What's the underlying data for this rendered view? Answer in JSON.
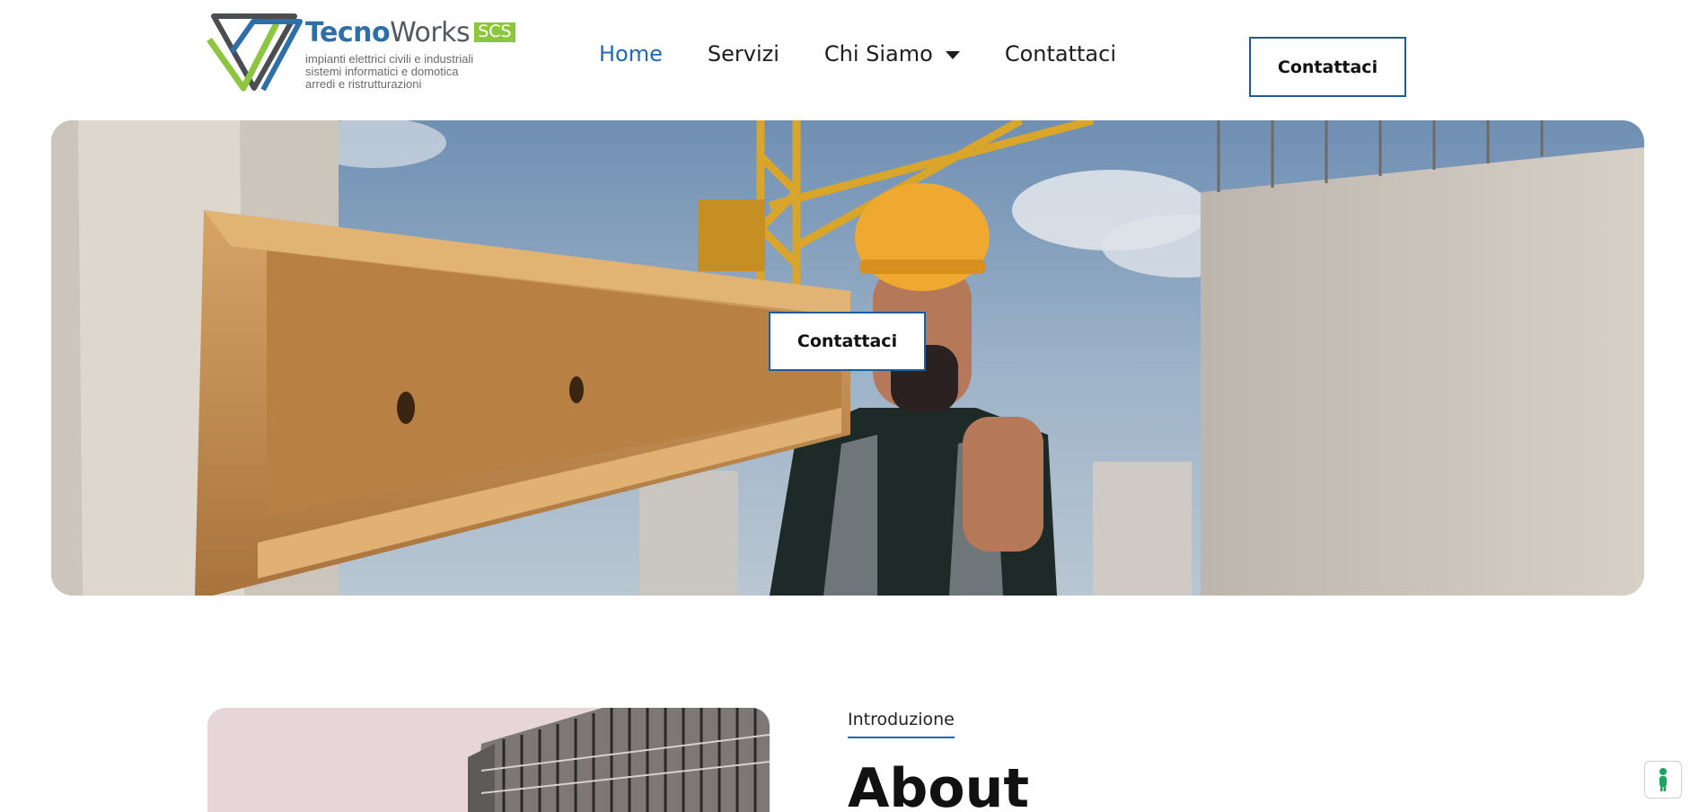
{
  "header": {
    "logo": {
      "brand_part1": "Tecno",
      "brand_part2": "Works",
      "brand_badge": "SCS",
      "tagline": [
        "impianti elettrici civili e industriali",
        "sistemi informatici e domotica",
        "arredi e ristrutturazioni"
      ],
      "colors": {
        "blue": "#2f6fa8",
        "green": "#8cc63f",
        "grey": "#55595e"
      }
    },
    "nav": [
      {
        "label": "Home",
        "active": true
      },
      {
        "label": "Servizi",
        "active": false
      },
      {
        "label": "Chi Siamo",
        "active": false,
        "has_dropdown": true
      },
      {
        "label": "Contattaci",
        "active": false
      }
    ],
    "cta_label": "Contattaci"
  },
  "hero": {
    "cta_label": "Contattaci",
    "image_icon": "construction-worker-carrying-beam-photo"
  },
  "about": {
    "eyebrow": "Introduzione",
    "title": "About",
    "image_icon": "building-facade-photo"
  },
  "accessibility": {
    "icon": "accessibility-icon",
    "color": "#1aa563"
  },
  "theme": {
    "accent": "#1f6bb0",
    "button_border": "#1f5d9a"
  }
}
